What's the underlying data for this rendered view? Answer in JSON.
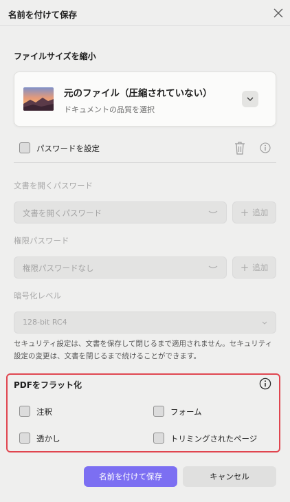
{
  "dialog": {
    "title": "名前を付けて保存"
  },
  "compress": {
    "section_label": "ファイルサイズを縮小",
    "quality_title": "元のファイル（圧縮されていない）",
    "quality_subtitle": "ドキュメントの品質を選択"
  },
  "security": {
    "password_checkbox_label": "パスワードを設定",
    "password_enabled": false,
    "open_password_label": "文書を開くパスワード",
    "open_password_value": "文書を開くパスワード",
    "open_add_label": "追加",
    "permission_password_label": "権限パスワード",
    "permission_password_value": "権限パスワードなし",
    "permission_add_label": "追加",
    "encryption_label": "暗号化レベル",
    "encryption_value": "128-bit RC4",
    "note": "セキュリティ設定は、文書を保存して閉じるまで適用されません。セキュリティ設定の変更は、文書を閉じるまで続けることができます。"
  },
  "flatten": {
    "section_label": "PDFをフラット化",
    "options": [
      {
        "label": "注釈",
        "checked": false
      },
      {
        "label": "フォーム",
        "checked": false
      },
      {
        "label": "透かし",
        "checked": false
      },
      {
        "label": "トリミングされたページ",
        "checked": false
      }
    ]
  },
  "actions": {
    "save_label": "名前を付けて保存",
    "cancel_label": "キャンセル"
  },
  "colors": {
    "primary": "#7c6ff2",
    "highlight_border": "#e0454f",
    "background": "#efefee"
  }
}
